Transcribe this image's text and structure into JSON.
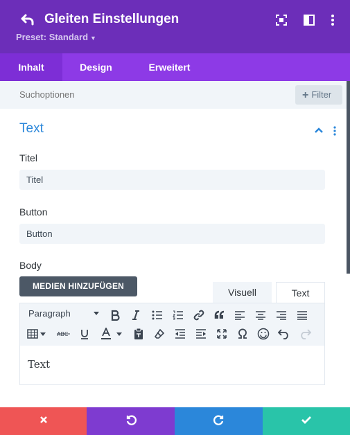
{
  "header": {
    "title": "Gleiten Einstellungen",
    "preset": "Preset: Standard",
    "icons": [
      "back-arrow-icon",
      "focus-mode-icon",
      "split-view-icon",
      "more-vertical-icon"
    ],
    "background": "#6c2eb9"
  },
  "tabs": [
    {
      "label": "Inhalt",
      "active": true
    },
    {
      "label": "Design",
      "active": false
    },
    {
      "label": "Erweitert",
      "active": false
    }
  ],
  "search": {
    "placeholder": "Suchoptionen",
    "filter_label": "Filter"
  },
  "section": {
    "title": "Text",
    "accent": "#2b87da",
    "fields": {
      "titel": {
        "label": "Titel",
        "value": "Titel"
      },
      "button": {
        "label": "Button",
        "value": "Button"
      },
      "body": {
        "label": "Body"
      }
    }
  },
  "editor": {
    "media_button": "MEDIEN HINZUFÜGEN",
    "tabs": {
      "visual": "Visuell",
      "text": "Text"
    },
    "format_select": "Paragraph",
    "content": "Text",
    "toolbar_row1": [
      "bold-icon",
      "italic-icon",
      "bullet-list-icon",
      "numbered-list-icon",
      "link-icon",
      "blockquote-icon",
      "align-left-icon",
      "align-center-icon",
      "align-right-icon",
      "justify-icon"
    ],
    "toolbar_row2": [
      "table-icon",
      "strikethrough-icon",
      "underline-icon",
      "text-color-icon",
      "paste-text-icon",
      "clear-format-icon",
      "outdent-icon",
      "indent-icon",
      "fullscreen-icon",
      "special-char-icon",
      "emoji-icon",
      "undo-icon",
      "redo-icon"
    ]
  },
  "footer": {
    "buttons": [
      {
        "name": "discard",
        "icon": "close-icon",
        "color": "#ef5555"
      },
      {
        "name": "undo",
        "icon": "undo-icon",
        "color": "#7e3bd0"
      },
      {
        "name": "redo",
        "icon": "redo-icon",
        "color": "#2b87da"
      },
      {
        "name": "save",
        "icon": "check-icon",
        "color": "#29c4a9"
      }
    ]
  }
}
